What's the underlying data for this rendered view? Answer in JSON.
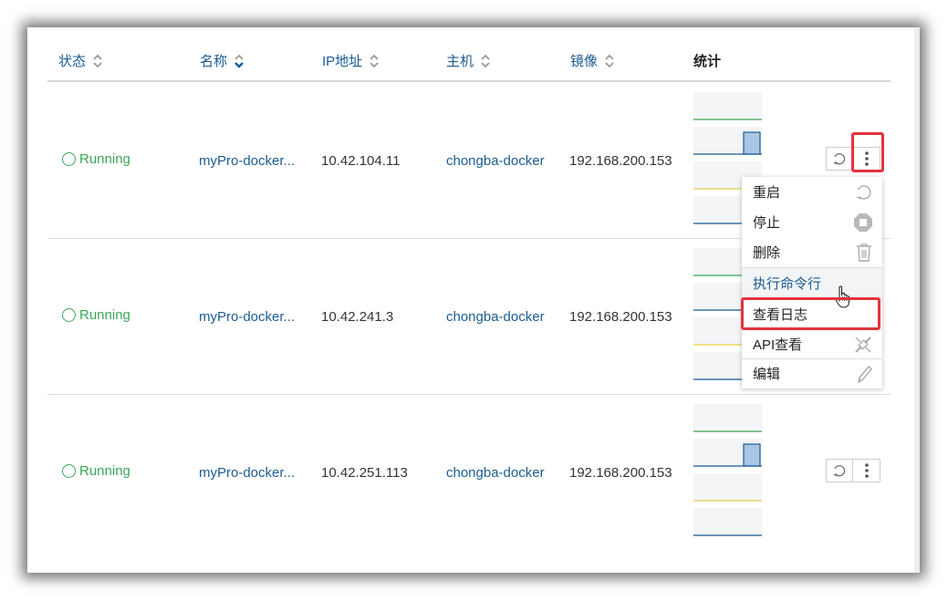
{
  "columns": [
    {
      "label": "状态",
      "sort": "both"
    },
    {
      "label": "名称",
      "sort": "desc"
    },
    {
      "label": "IP地址",
      "sort": "both"
    },
    {
      "label": "主机",
      "sort": "both"
    },
    {
      "label": "镜像",
      "sort": "both"
    },
    {
      "label": "统计",
      "sort": "none"
    }
  ],
  "rows": [
    {
      "status": "Running",
      "name": "myPro-docker...",
      "ip": "10.42.104.11",
      "host": "chongba-docker",
      "image": "192.168.200.153"
    },
    {
      "status": "Running",
      "name": "myPro-docker...",
      "ip": "10.42.241.3",
      "host": "chongba-docker",
      "image": "192.168.200.153"
    },
    {
      "status": "Running",
      "name": "myPro-docker...",
      "ip": "10.42.251.113",
      "host": "chongba-docker",
      "image": "192.168.200.153"
    }
  ],
  "stat_lines": {
    "cpu": "#3aa757",
    "memory": "#1b5c92",
    "network": "#f0d24a",
    "storage": "#1b5c92"
  },
  "menu": {
    "items": [
      {
        "label": "重启",
        "icon": "restart-icon"
      },
      {
        "label": "停止",
        "icon": "stop-icon"
      },
      {
        "label": "删除",
        "icon": "trash-icon"
      },
      {
        "label": "执行命令行",
        "icon": "",
        "hovered": true
      },
      {
        "label": "查看日志",
        "icon": ""
      },
      {
        "label": "API查看",
        "icon": "api-icon"
      },
      {
        "label": "编辑",
        "icon": "pencil-icon"
      }
    ]
  },
  "colors": {
    "link": "#1b5c92",
    "running": "#3aa757",
    "highlight": "#e3343e"
  }
}
